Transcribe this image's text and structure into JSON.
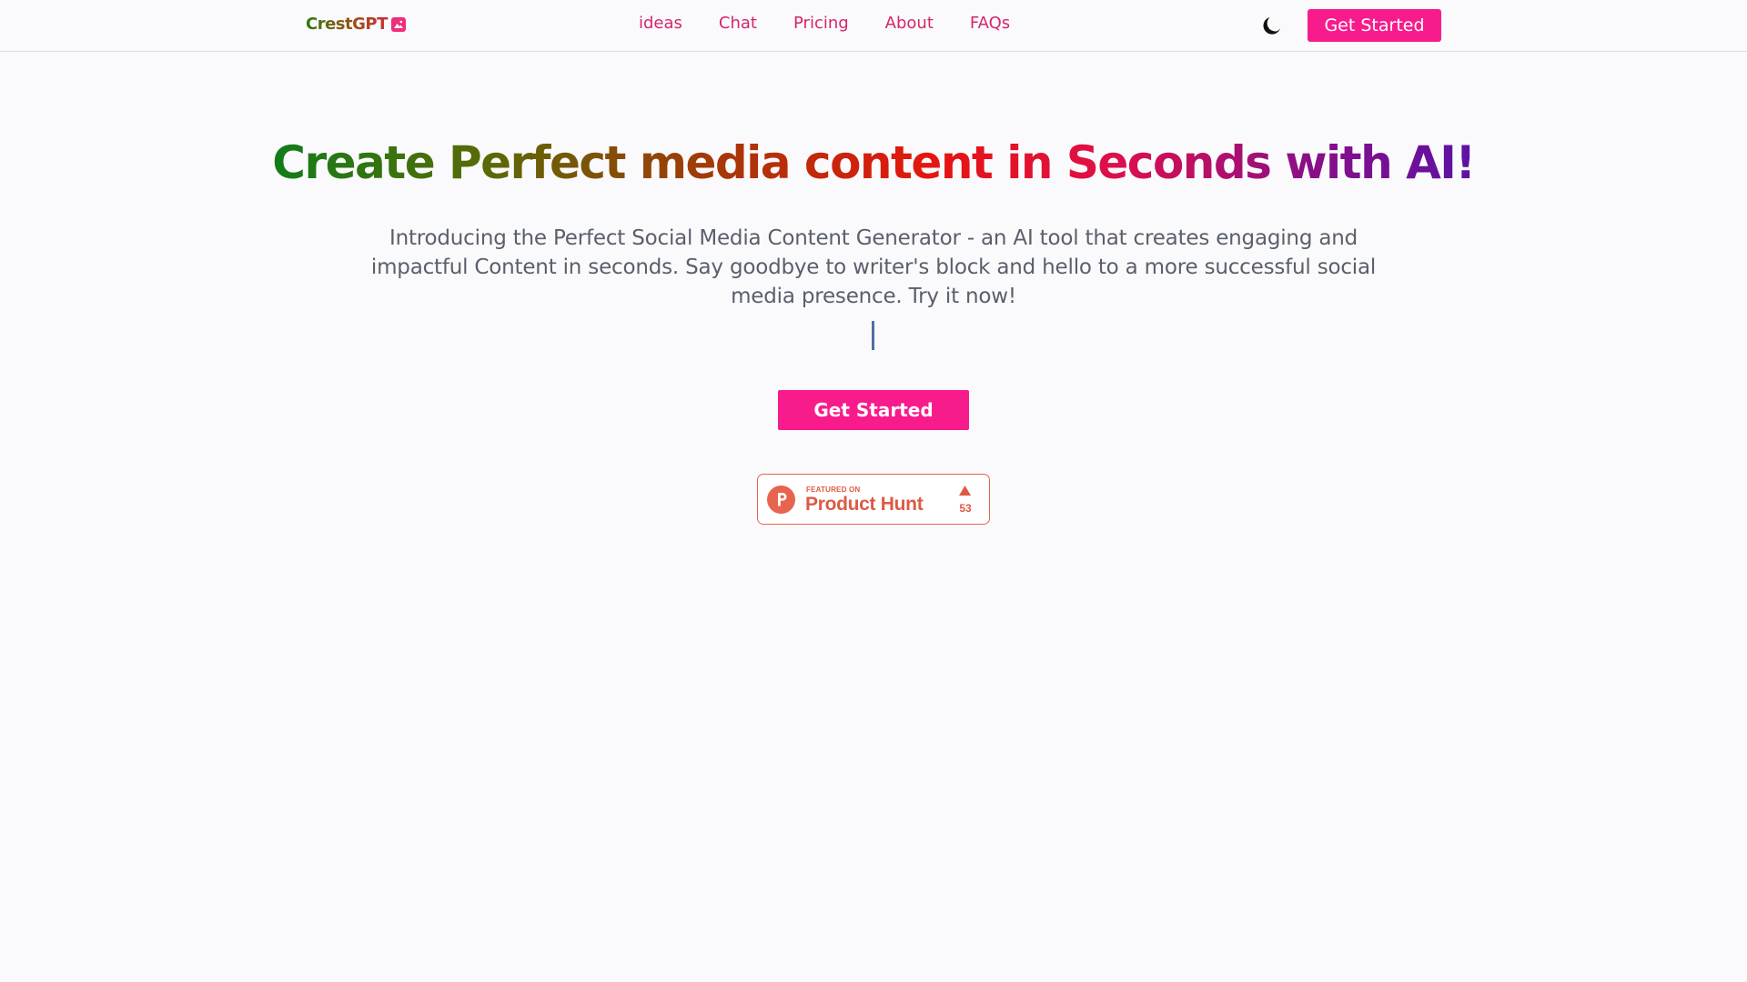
{
  "header": {
    "logo_text": "CrestGPT",
    "nav_links": [
      {
        "label": "ideas"
      },
      {
        "label": "Chat"
      },
      {
        "label": "Pricing"
      },
      {
        "label": "About"
      },
      {
        "label": "FAQs"
      }
    ],
    "theme_toggle_icon": "moon-icon",
    "cta_label": "Get Started"
  },
  "hero": {
    "title": "Create Perfect media content in Seconds with AI!",
    "description": "Introducing the Perfect Social Media Content Generator - an AI tool that creates engaging and impactful Content in seconds. Say goodbye to writer's block and hello to a more successful social media presence. Try it now!",
    "cta_label": "Get Started"
  },
  "product_hunt": {
    "featured_label": "FEATURED ON",
    "name": "Product Hunt",
    "upvotes": "53",
    "icon": "product-hunt-icon"
  },
  "colors": {
    "accent": "#f81b8c",
    "nav_link": "#d6256d",
    "product_hunt": "#dc5a44",
    "background": "#fafafc"
  }
}
